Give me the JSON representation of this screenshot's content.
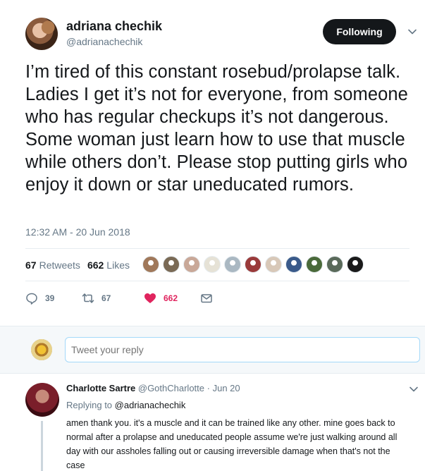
{
  "tweet": {
    "author_name": "adriana chechik",
    "author_handle": "@adrianachechik",
    "follow_label": "Following",
    "text": "I’m tired of this constant rosebud/prolapse talk. Ladies I get it’s not for everyone, from someone who has regular checkups it’s not dangerous. Some woman just learn how to use that muscle while others don’t. Please stop putting girls who enjoy it down or star uneducated rumors.",
    "timestamp": "12:32 AM - 20 Jun 2018",
    "retweets_count": "67",
    "retweets_label": "Retweets",
    "likes_count": "662",
    "likes_label": "Likes",
    "likers": [
      {
        "icon": "liker-avatar-1",
        "color": "#a0785a"
      },
      {
        "icon": "liker-avatar-2",
        "color": "#7a6a55"
      },
      {
        "icon": "liker-avatar-3",
        "color": "#c9a898"
      },
      {
        "icon": "liker-avatar-4",
        "color": "#e6e2d6"
      },
      {
        "icon": "liker-avatar-default",
        "color": "#aab8c2"
      },
      {
        "icon": "liker-avatar-6",
        "color": "#9a3a3a"
      },
      {
        "icon": "liker-avatar-7",
        "color": "#d8c8b8"
      },
      {
        "icon": "liker-avatar-8",
        "color": "#3a5a8a"
      },
      {
        "icon": "liker-avatar-9",
        "color": "#4a6a3a"
      },
      {
        "icon": "liker-avatar-10",
        "color": "#5a6a5a"
      },
      {
        "icon": "liker-avatar-11",
        "color": "#1a1a1a"
      }
    ],
    "actions": {
      "reply_count": "39",
      "retweet_count": "67",
      "like_count": "662"
    }
  },
  "reply_box": {
    "placeholder": "Tweet your reply"
  },
  "reply": {
    "author_name": "Charlotte Sartre",
    "author_handle": "@GothCharlotte",
    "separator": "·",
    "date": "Jun 20",
    "replying_prefix": "Replying to",
    "replying_to": "@adrianachechik",
    "text": "amen thank you. it's a muscle and it can be trained like any other. mine goes back to normal after a prolapse and uneducated people assume we're just walking around all day with our assholes falling out or causing irreversible damage when that's not the case"
  },
  "colors": {
    "accent_blue": "#1da1f2",
    "like_red": "#e0245e",
    "muted_gray": "#657786",
    "text_dark": "#14171a"
  }
}
